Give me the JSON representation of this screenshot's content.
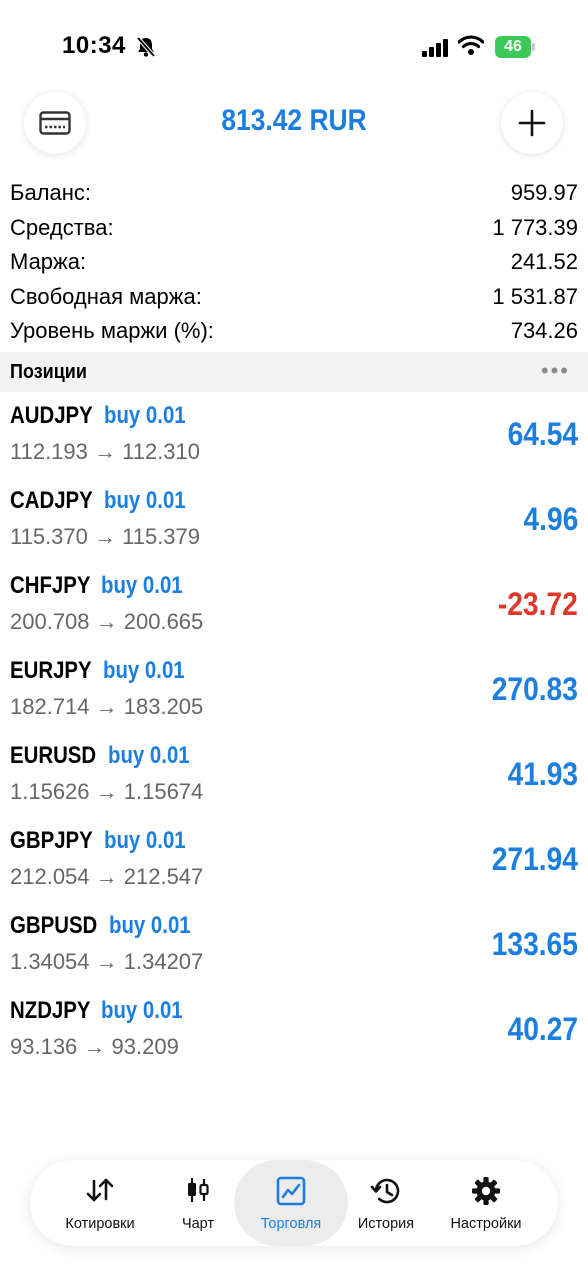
{
  "status": {
    "time": "10:34",
    "battery": "46"
  },
  "header": {
    "balance_display": "813.42 RUR"
  },
  "summary": [
    {
      "label": "Баланс:",
      "value": "959.97"
    },
    {
      "label": "Средства:",
      "value": "1 773.39"
    },
    {
      "label": "Маржа:",
      "value": "241.52"
    },
    {
      "label": "Свободная маржа:",
      "value": "1 531.87"
    },
    {
      "label": "Уровень маржи (%):",
      "value": "734.26"
    }
  ],
  "positions_section": {
    "title": "Позиции"
  },
  "positions": [
    {
      "symbol": "AUDJPY",
      "side": "buy 0.01",
      "prices": "112.193 → 112.310",
      "profit": "64.54"
    },
    {
      "symbol": "CADJPY",
      "side": "buy 0.01",
      "prices": "115.370 → 115.379",
      "profit": "4.96"
    },
    {
      "symbol": "CHFJPY",
      "side": "buy 0.01",
      "prices": "200.708 → 200.665",
      "profit": "-23.72"
    },
    {
      "symbol": "EURJPY",
      "side": "buy 0.01",
      "prices": "182.714 → 183.205",
      "profit": "270.83"
    },
    {
      "symbol": "EURUSD",
      "side": "buy 0.01",
      "prices": "1.15626 → 1.15674",
      "profit": "41.93"
    },
    {
      "symbol": "GBPJPY",
      "side": "buy 0.01",
      "prices": "212.054 → 212.547",
      "profit": "271.94"
    },
    {
      "symbol": "GBPUSD",
      "side": "buy 0.01",
      "prices": "1.34054 → 1.34207",
      "profit": "133.65"
    },
    {
      "symbol": "NZDJPY",
      "side": "buy 0.01",
      "prices": "93.136 → 93.209",
      "profit": "40.27"
    }
  ],
  "tabs": [
    {
      "label": "Котировки",
      "icon": "quotes-arrows-icon"
    },
    {
      "label": "Чарт",
      "icon": "candlestick-chart-icon"
    },
    {
      "label": "Торговля",
      "icon": "trade-chart-icon",
      "active": true
    },
    {
      "label": "История",
      "icon": "history-clock-icon"
    },
    {
      "label": "Настройки",
      "icon": "gear-icon"
    }
  ],
  "colors": {
    "accent": "#1a7fe0",
    "negative": "#e0392b",
    "battery": "#3dc85a"
  }
}
